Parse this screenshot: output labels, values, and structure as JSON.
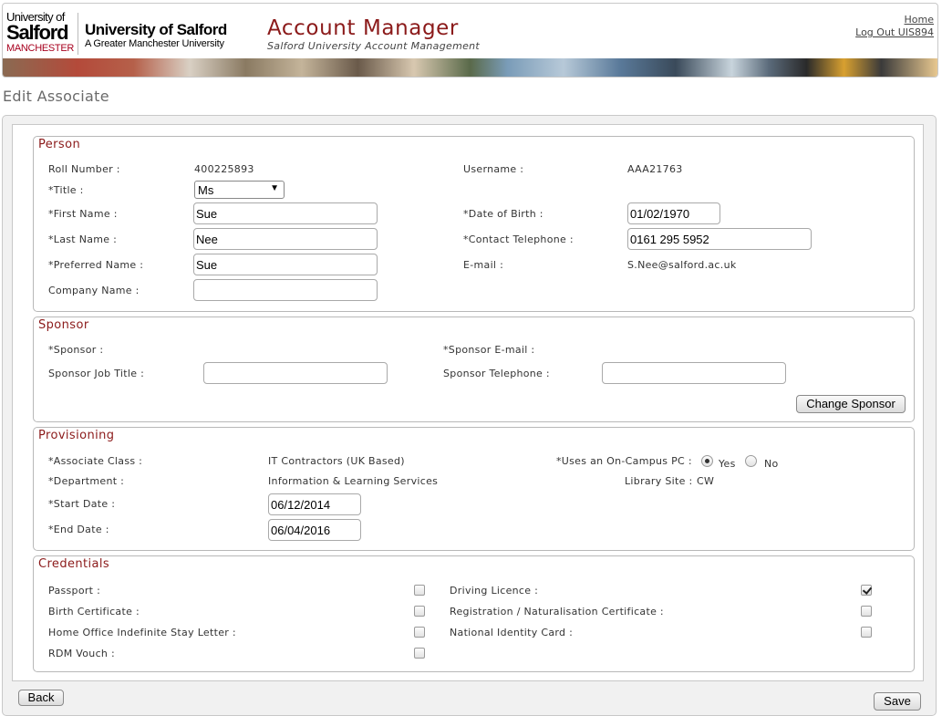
{
  "header": {
    "logo_manchester_line1": "University of",
    "logo_manchester_line2": "Salford",
    "logo_manchester_line3": "MANCHESTER",
    "logo_salford_line1": "University of Salford",
    "logo_salford_line2": "A Greater Manchester University",
    "app_title": "Account Manager",
    "app_subtitle": "Salford University Account Management",
    "home_link": "Home",
    "logout_link": "Log Out UIS894"
  },
  "page_title": "Edit Associate",
  "person": {
    "legend": "Person",
    "roll_number_label": "Roll Number :",
    "roll_number": "400225893",
    "username_label": "Username :",
    "username": "AAA21763",
    "title_label": "*Title :",
    "title_value": "Ms",
    "first_name_label": "*First Name :",
    "first_name": "Sue",
    "dob_label": "*Date of Birth :",
    "dob": "01/02/1970",
    "last_name_label": "*Last Name :",
    "last_name": "Nee",
    "contact_tel_label": "*Contact Telephone :",
    "contact_tel": "0161 295 5952",
    "preferred_name_label": "*Preferred Name :",
    "preferred_name": "Sue",
    "email_label": "E-mail :",
    "email": "S.Nee@salford.ac.uk",
    "company_label": "Company Name :",
    "company": ""
  },
  "sponsor": {
    "legend": "Sponsor",
    "sponsor_label": "*Sponsor :",
    "sponsor_email_label": "*Sponsor E-mail :",
    "job_title_label": "Sponsor Job Title :",
    "job_title": "",
    "telephone_label": "Sponsor Telephone :",
    "telephone": "",
    "change_button": "Change Sponsor"
  },
  "provisioning": {
    "legend": "Provisioning",
    "class_label": "*Associate Class :",
    "class_value": "IT Contractors (UK Based)",
    "oncampus_label": "*Uses an On-Campus PC :",
    "yes_label": "Yes",
    "no_label": "No",
    "oncampus_selected": "Yes",
    "department_label": "*Department :",
    "department_value": "Information & Learning Services",
    "library_site_label": "Library Site :",
    "library_site_value": "CW",
    "start_date_label": "*Start Date :",
    "start_date": "06/12/2014",
    "end_date_label": "*End Date :",
    "end_date": "06/04/2016"
  },
  "credentials": {
    "legend": "Credentials",
    "passport_label": "Passport :",
    "passport_checked": false,
    "driving_licence_label": "Driving Licence :",
    "driving_licence_checked": true,
    "birth_cert_label": "Birth Certificate :",
    "birth_cert_checked": false,
    "registration_label": "Registration / Naturalisation Certificate :",
    "registration_checked": false,
    "home_office_label": "Home Office Indefinite Stay Letter :",
    "home_office_checked": false,
    "national_id_label": "National Identity Card :",
    "national_id_checked": false,
    "rdm_label": "RDM Vouch :",
    "rdm_checked": false
  },
  "footer": {
    "back_button": "Back",
    "save_button": "Save"
  }
}
